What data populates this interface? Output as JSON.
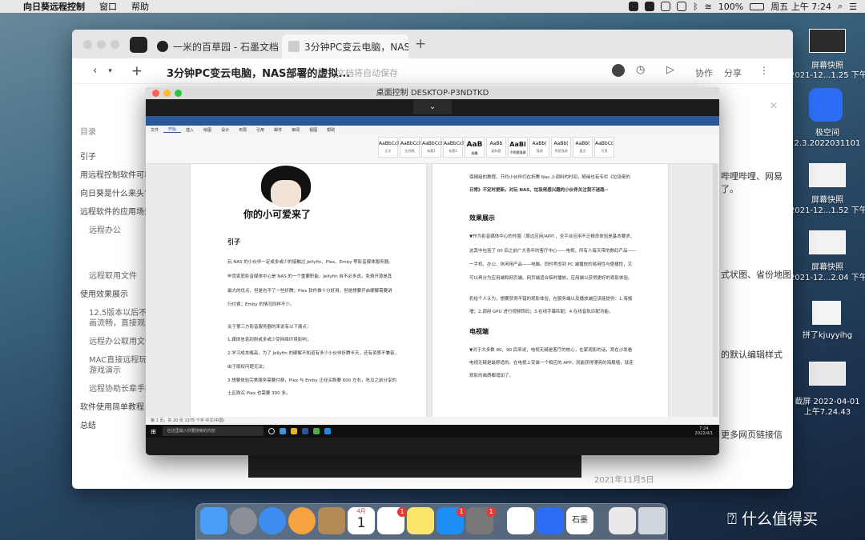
{
  "menubar": {
    "app": "向日葵远程控制",
    "items": [
      "窗口",
      "帮助"
    ],
    "battery": "100%",
    "datetime": "周五 上午 7:24"
  },
  "browser": {
    "tabs": [
      {
        "label": "一米的百草园 - 石墨文档"
      },
      {
        "label": "3分钟PC变云电脑，NAS"
      }
    ],
    "new_tab": "+",
    "doc_title": "3分钟PC变云电脑，NAS部署的虚拟...",
    "autosave": "文档将自动保存",
    "actions": {
      "collab": "协作",
      "share": "分享"
    },
    "outline": {
      "heading": "目录",
      "items": [
        {
          "label": "引子",
          "level": 1
        },
        {
          "label": "用远程控制软件可以",
          "level": 1
        },
        {
          "label": "向日葵是什么来头?",
          "level": 1
        },
        {
          "label": "远程软件的应用场景",
          "level": 1
        },
        {
          "label": "远程办公",
          "level": 2
        },
        {
          "label": "远程取用文件",
          "level": 2
        },
        {
          "label": "使用效果展示",
          "level": 1
        },
        {
          "label": "12.5版本以后不限",
          "level": 2
        },
        {
          "label": "画流畅，直接观影",
          "level": 2
        },
        {
          "label": "远程办公取用文件",
          "level": 2
        },
        {
          "label": "MAC直接远程玩P",
          "level": 2
        },
        {
          "label": "游戏演示",
          "level": 2
        },
        {
          "label": "远程协助长辈手机",
          "level": 2
        },
        {
          "label": "软件使用简单教程",
          "level": 1
        },
        {
          "label": "总结",
          "level": 1
        }
      ]
    },
    "right_snippets": [
      "哔哩哔哩、网易",
      "了。",
      "式状图、省份地图",
      "的默认编辑样式",
      "更多网页链接信",
      "2021年11月5日"
    ]
  },
  "remote": {
    "title": "桌面控制 DESKTOP-P3NDTKD",
    "word": {
      "tabs": [
        "文件",
        "开始",
        "插入",
        "绘图",
        "设计",
        "布局",
        "引用",
        "邮件",
        "审阅",
        "视图",
        "帮助"
      ],
      "styles": [
        "AaBbCcl",
        "AaBbCcl",
        "AaBbCcl",
        "AaBbCcl",
        "AaB",
        "AaBb",
        "AaBl",
        "AaBb(",
        "AaBb(",
        "AaBb(",
        "AaBbCc"
      ],
      "style_names": [
        "正文",
        "无间隔",
        "标题1",
        "标题2",
        "标题",
        "副标题",
        "不明显强调",
        "强调",
        "明显强调",
        "要点",
        "引用"
      ],
      "page_left": {
        "caption": "你的小可爱来了",
        "heading": "引子",
        "lines": [
          "玩 NAS 的小伙伴一定或多或少的接触过 Jellyfin、Plex、Emby 等影音媒体服务器。",
          "毕竟家庭影音媒体中心是 NAS 的一个重要职能。Jellyfin 自不必多说，免费开源是其",
          "最大的优点，但是也不了一些折腾；Plex 软件做十分好用，但是想要开启硬解需要讲",
          "行付费；Emby 的情况同样不少。",
          "关于第三方影音服务器的来说有以下痛点：",
          "1.媒体信息刮削或多或少受网络环境影响；",
          "2.学习成本略高，为了 Jellyfin 的硬解不知道有多少小伙伴折腾半天，还有资质不兼容，",
          "由于版权问题无法；",
          "3.想要体验完美服务需要付费，Plex 与 Emby 正经买断要 600 左右，吃瓜之前分享的",
          "土区购买 Plex 也需要 300 多。"
        ]
      },
      "page_right": {
        "lines_top": [
          "保姆级的教程。节约小伙伴们在折腾 Nas 上调料的时间，随缘也有专栏《垃圾佬的",
          "日常》不定时更新。对玩 NAS、垃圾佬感兴趣的小伙伴关注我不迷路~"
        ],
        "heading1": "效果展示",
        "lines_mid": [
          "▼作为影音媒体中心的外围（周边应用/APP），全平台应用不乏精良体验是基本要求，",
          "这其中包括了 00 后之前广大青年的客厅中心——电视，所有人每天带的数码产品——",
          "一手机、办公、休闲用产品——电脑。同时考虑到 PC 端播放的易用性与便捷性，又",
          "可以再分为应用端和网页端。网页端适合临时播放，应用端以获得更好的观影体验。",
          "扔给个人认为，想要获得不错的观影体验，在服务端以及播放端应该能提供：1.海报",
          "墙；2.调用 GPU 进行视频转码；3.在线字幕匹配；4.在线音轨匹配功能。"
        ],
        "heading2": "电视端",
        "lines_bottom": [
          "▼对于大多数 80、90 后来说，电视无疑是客厅的核心，在家观影的话，窝在沙发看",
          "电视无疑是最舒适的。在电视上安装一个相应的 APP，就能获得漂亮的海报墙，就连",
          "观影的画质都增加了。"
        ]
      },
      "status": "第 1 页，共 20 页    1375 个字    中文(中国)",
      "search_placeholder": "在这里输入你要搜索的内容",
      "clock": "7:24\n2022/4/1"
    }
  },
  "desktop_icons": [
    {
      "name": "屏幕快照",
      "sub": "2021-12...1.25 下午"
    },
    {
      "name": "极空间",
      "sub": "2.3.2022031101"
    },
    {
      "name": "屏幕快照",
      "sub": "2021-12...1.52 下午"
    },
    {
      "name": "屏幕快照",
      "sub": "2021-12...2.04 下午"
    },
    {
      "name": "拼了kjuyyihg",
      "sub": ""
    },
    {
      "name": "截屏 2022-04-01",
      "sub": "上午7.24.43"
    }
  ],
  "dock": {
    "badges": {
      "calendar_month": "4月",
      "calendar_day": "1",
      "reminders": "1",
      "appstore": "1",
      "prefs": "1"
    },
    "shimo_label": "石墨"
  },
  "watermark": "什么值得买",
  "colors": {
    "word_blue": "#2b579a",
    "link_blue": "#1a5fb4",
    "accent_red": "#e53935"
  }
}
